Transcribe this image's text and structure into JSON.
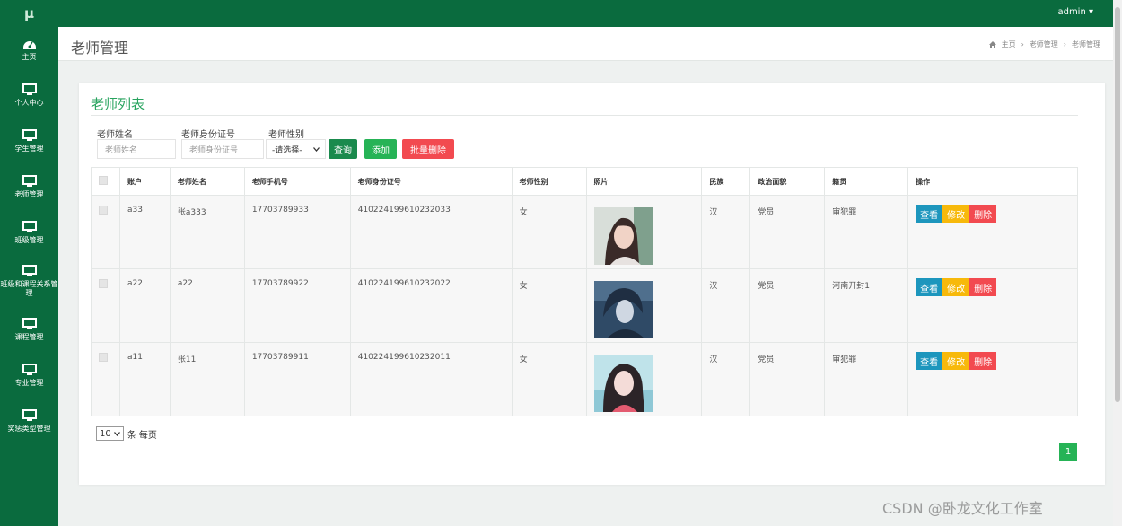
{
  "app": {
    "logo": "μ",
    "user_menu": "admin ▾"
  },
  "sidebar": {
    "items": [
      {
        "label": "主页",
        "icon": "dashboard-icon"
      },
      {
        "label": "个人中心",
        "icon": "monitor-icon"
      },
      {
        "label": "学生管理",
        "icon": "monitor-icon"
      },
      {
        "label": "老师管理",
        "icon": "monitor-icon"
      },
      {
        "label": "班级管理",
        "icon": "monitor-icon"
      },
      {
        "label": "班级和课程关系管理",
        "icon": "monitor-icon"
      },
      {
        "label": "课程管理",
        "icon": "monitor-icon"
      },
      {
        "label": "专业管理",
        "icon": "monitor-icon"
      },
      {
        "label": "奖惩类型管理",
        "icon": "monitor-icon"
      }
    ]
  },
  "header": {
    "title": "老师管理",
    "breadcrumb": [
      "主页",
      "老师管理",
      "老师管理"
    ],
    "breadcrumb_sep": "›"
  },
  "main": {
    "card_title": "老师列表",
    "filters": {
      "name_label": "老师姓名",
      "name_placeholder": "老师姓名",
      "idcard_label": "老师身份证号",
      "idcard_placeholder": "老师身份证号",
      "gender_label": "老师性别",
      "gender_selected": "-请选择-"
    },
    "buttons": {
      "search": "查询",
      "add": "添加",
      "batch_delete": "批量删除"
    },
    "table": {
      "columns": [
        "",
        "账户",
        "老师姓名",
        "老师手机号",
        "老师身份证号",
        "老师性别",
        "照片",
        "民族",
        "政治面貌",
        "籍贯",
        "操作"
      ],
      "rows": [
        {
          "account": "a33",
          "name": "张a333",
          "phone": "17703789933",
          "idcard": "410224199610232033",
          "gender": "女",
          "ethnicity": "汉",
          "political": "党员",
          "hometown": "审犯罪"
        },
        {
          "account": "a22",
          "name": "a22",
          "phone": "17703789922",
          "idcard": "410224199610232022",
          "gender": "女",
          "ethnicity": "汉",
          "political": "党员",
          "hometown": "河南开封1"
        },
        {
          "account": "a11",
          "name": "张11",
          "phone": "17703789911",
          "idcard": "410224199610232011",
          "gender": "女",
          "ethnicity": "汉",
          "political": "党员",
          "hometown": "审犯罪"
        }
      ],
      "row_actions": {
        "view": "查看",
        "edit": "修改",
        "delete": "删除"
      }
    },
    "pagination": {
      "page_size": "10",
      "per_page_label": "条 每页",
      "current_page": "1"
    }
  },
  "watermark": "CSDN @卧龙文化工作室",
  "colors": {
    "sidebar_bg": "#0a6b3e",
    "accent_green": "#26b356",
    "view_blue": "#1d96bd",
    "edit_yellow": "#f7b90b",
    "delete_red": "#f24a50"
  }
}
